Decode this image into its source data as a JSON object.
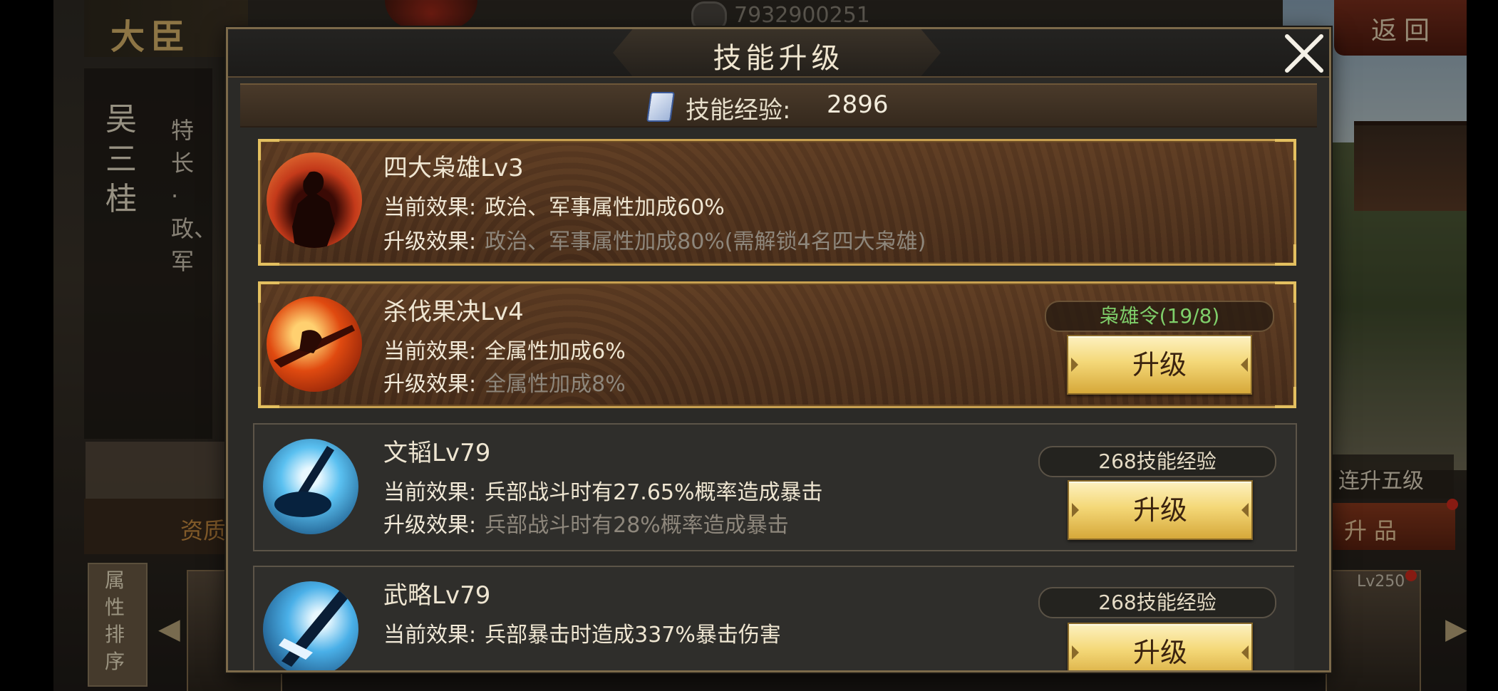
{
  "background": {
    "title": "大臣",
    "minister_name": "吴三桂",
    "specialty": "特长·政、军",
    "player_id": "7932900251",
    "back_label": "返回",
    "five_levels_label": "连升五级",
    "promote_label": "升品",
    "left_tab_label": "资质",
    "sort_label": "属性排序",
    "level_tag": "Lv250"
  },
  "dialog": {
    "title": "技能升级",
    "exp_label": "技能经验:",
    "exp_value": "2896"
  },
  "skills": [
    {
      "name": "四大枭雄Lv3",
      "current_label": "当前效果:",
      "current_effect": "政治、军事属性加成60%",
      "next_label": "升级效果:",
      "next_effect": "政治、军事属性加成80%(需解锁4名四大枭雄)",
      "icon": "silhouette-warrior-icon"
    },
    {
      "name": "杀伐果决Lv4",
      "current_label": "当前效果:",
      "current_effect": "全属性加成6%",
      "next_label": "升级效果:",
      "next_effect": "全属性加成8%",
      "cost": "枭雄令(19/8)",
      "button": "升级",
      "icon": "sword-strike-icon"
    },
    {
      "name": "文韬Lv79",
      "current_label": "当前效果:",
      "current_effect": "兵部战斗时有27.65%概率造成暴击",
      "next_label": "升级效果:",
      "next_effect": "兵部战斗时有28%概率造成暴击",
      "cost": "268技能经验",
      "button": "升级",
      "icon": "brush-ink-icon"
    },
    {
      "name": "武略Lv79",
      "current_label": "当前效果:",
      "current_effect": "兵部暴击时造成337%暴击伤害",
      "cost": "268技能经验",
      "button": "升级",
      "icon": "blade-icon"
    }
  ],
  "colors": {
    "gold_border": "#c8a050",
    "cost_green": "#7fcf6a",
    "cost_normal": "#e6dcc6",
    "button_text": "#3b230f"
  }
}
